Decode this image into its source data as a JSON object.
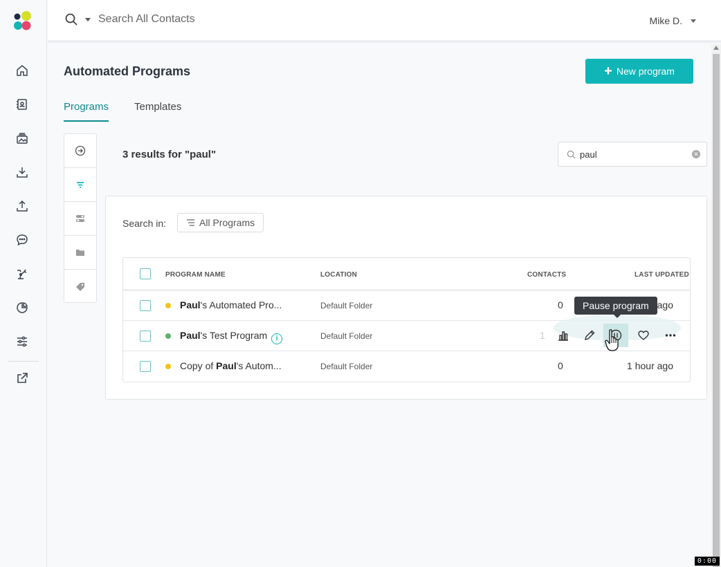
{
  "topbar": {
    "search_placeholder": "Search All Contacts",
    "user_name": "Mike D."
  },
  "header": {
    "title": "Automated Programs",
    "new_program_label": "New program"
  },
  "tabs": [
    {
      "label": "Programs",
      "active": true
    },
    {
      "label": "Templates",
      "active": false
    }
  ],
  "results": {
    "title": "3 results for \"paul\"",
    "search_value": "paul"
  },
  "card": {
    "search_in_label": "Search in:",
    "search_in_value": "All Programs"
  },
  "table": {
    "columns": [
      "PROGRAM NAME",
      "LOCATION",
      "CONTACTS",
      "LAST UPDATED"
    ],
    "rows": [
      {
        "name_bold": "Paul",
        "name_rest": "'s Automated Pro...",
        "status_color": "#f5c518",
        "location": "Default Folder",
        "contacts": "0",
        "updated": "1 hour ago"
      },
      {
        "name_bold": "Paul",
        "name_rest": "'s Test Program",
        "status_color": "#5bb36a",
        "location": "Default Folder",
        "contacts": "1",
        "updated": ""
      },
      {
        "name_prefix": "Copy of ",
        "name_bold": "Paul",
        "name_rest": "'s Autom...",
        "status_color": "#f5c518",
        "location": "Default Folder",
        "contacts": "0",
        "updated": "1 hour ago"
      }
    ]
  },
  "tooltip": "Pause program",
  "timer": "0:00",
  "colors": {
    "accent": "#0fb5b7",
    "tab_active": "#0e8b8d",
    "status_active": "#5bb36a",
    "status_paused": "#f5c518"
  }
}
